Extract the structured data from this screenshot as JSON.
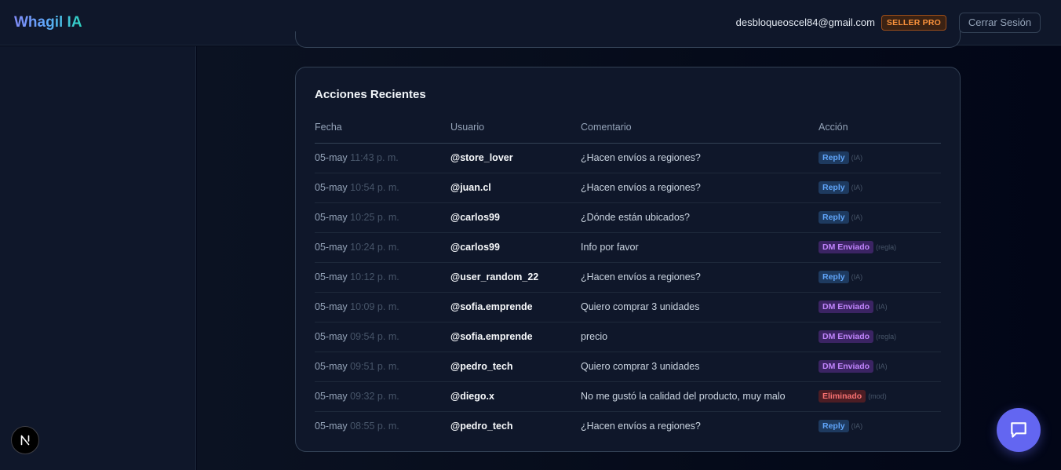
{
  "app": {
    "title": "Whagil IA"
  },
  "header": {
    "email": "desbloqueoscel84@gmail.com",
    "plan_badge": "SELLER PRO",
    "logout_label": "Cerrar Sesión"
  },
  "recent_actions": {
    "title": "Acciones Recientes",
    "columns": [
      "Fecha",
      "Usuario",
      "Comentario",
      "Acción"
    ],
    "rows": [
      {
        "day": "05-may",
        "time": "11:43 p. m.",
        "user": "@store_lover",
        "comment": "¿Hacen envíos a regiones?",
        "action": "Reply",
        "action_type": "reply",
        "source": "(IA)"
      },
      {
        "day": "05-may",
        "time": "10:54 p. m.",
        "user": "@juan.cl",
        "comment": "¿Hacen envíos a regiones?",
        "action": "Reply",
        "action_type": "reply",
        "source": "(IA)"
      },
      {
        "day": "05-may",
        "time": "10:25 p. m.",
        "user": "@carlos99",
        "comment": "¿Dónde están ubicados?",
        "action": "Reply",
        "action_type": "reply",
        "source": "(IA)"
      },
      {
        "day": "05-may",
        "time": "10:24 p. m.",
        "user": "@carlos99",
        "comment": "Info por favor",
        "action": "DM Enviado",
        "action_type": "dm",
        "source": "(regla)"
      },
      {
        "day": "05-may",
        "time": "10:12 p. m.",
        "user": "@user_random_22",
        "comment": "¿Hacen envíos a regiones?",
        "action": "Reply",
        "action_type": "reply",
        "source": "(IA)"
      },
      {
        "day": "05-may",
        "time": "10:09 p. m.",
        "user": "@sofia.emprende",
        "comment": "Quiero comprar 3 unidades",
        "action": "DM Enviado",
        "action_type": "dm",
        "source": "(IA)"
      },
      {
        "day": "05-may",
        "time": "09:54 p. m.",
        "user": "@sofia.emprende",
        "comment": "precio",
        "action": "DM Enviado",
        "action_type": "dm",
        "source": "(regla)"
      },
      {
        "day": "05-may",
        "time": "09:51 p. m.",
        "user": "@pedro_tech",
        "comment": "Quiero comprar 3 unidades",
        "action": "DM Enviado",
        "action_type": "dm",
        "source": "(IA)"
      },
      {
        "day": "05-may",
        "time": "09:32 p. m.",
        "user": "@diego.x",
        "comment": "No me gustó la calidad del producto, muy malo",
        "action": "Eliminado",
        "action_type": "del",
        "source": "(mod)"
      },
      {
        "day": "05-may",
        "time": "08:55 p. m.",
        "user": "@pedro_tech",
        "comment": "¿Hacen envíos a regiones?",
        "action": "Reply",
        "action_type": "reply",
        "source": "(IA)"
      }
    ]
  },
  "icons": {
    "dev_badge": "nextjs-n-icon",
    "chat": "chat-bubble-icon"
  },
  "colors": {
    "accent": "#6366f1",
    "reply": "#60a5fa",
    "dm": "#c084fc",
    "deleted": "#f87171",
    "plan": "#fb923c"
  }
}
